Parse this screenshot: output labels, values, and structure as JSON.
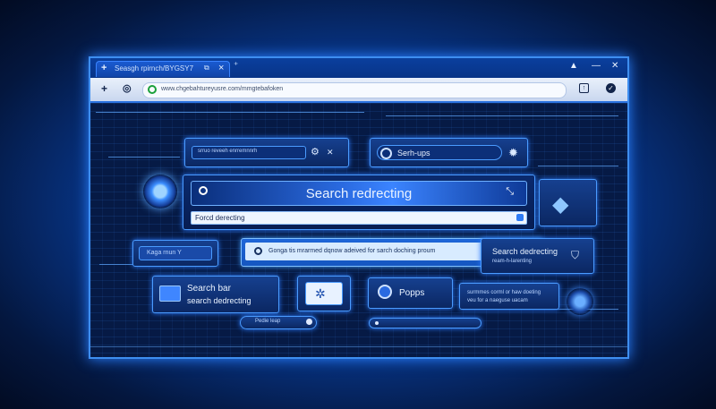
{
  "browser": {
    "tab_title": "Seasgh rpirnch/BYGSY7",
    "url": "www.chgebahtureyusre.com/mmgtebafoken"
  },
  "panels": {
    "top_left_field": "srruo reveeh enrremnnrh",
    "top_right_label": "Serh-ups",
    "main_title": "Search redrecting",
    "sub_field": "Forcd derecting",
    "left_button": "Kaga rnun Y",
    "notice": "Gonga tis mrarmed dqnow adeived for sarch doching proum",
    "right_title": "Search dedrecting",
    "right_sub": "ream-h-larenting",
    "search_bar_title": "Search bar",
    "search_bar_sub": "search dedrecting",
    "popps_label": "Popps",
    "popup_text_1": "surmmes corml or haw doeting",
    "popup_text_2": "veu for a naeguse uacam",
    "bottom_pill": "Pedie    leap"
  },
  "icons": {
    "new_tab": "plus-icon",
    "refresh": "refresh-icon",
    "secure": "shield-icon",
    "share": "share-icon",
    "profile": "profile-icon",
    "virus": "virus-icon",
    "gear": "gear-icon",
    "search": "search-icon",
    "close": "close-icon"
  },
  "colors": {
    "accent": "#3b84ff",
    "background": "#061a45"
  }
}
